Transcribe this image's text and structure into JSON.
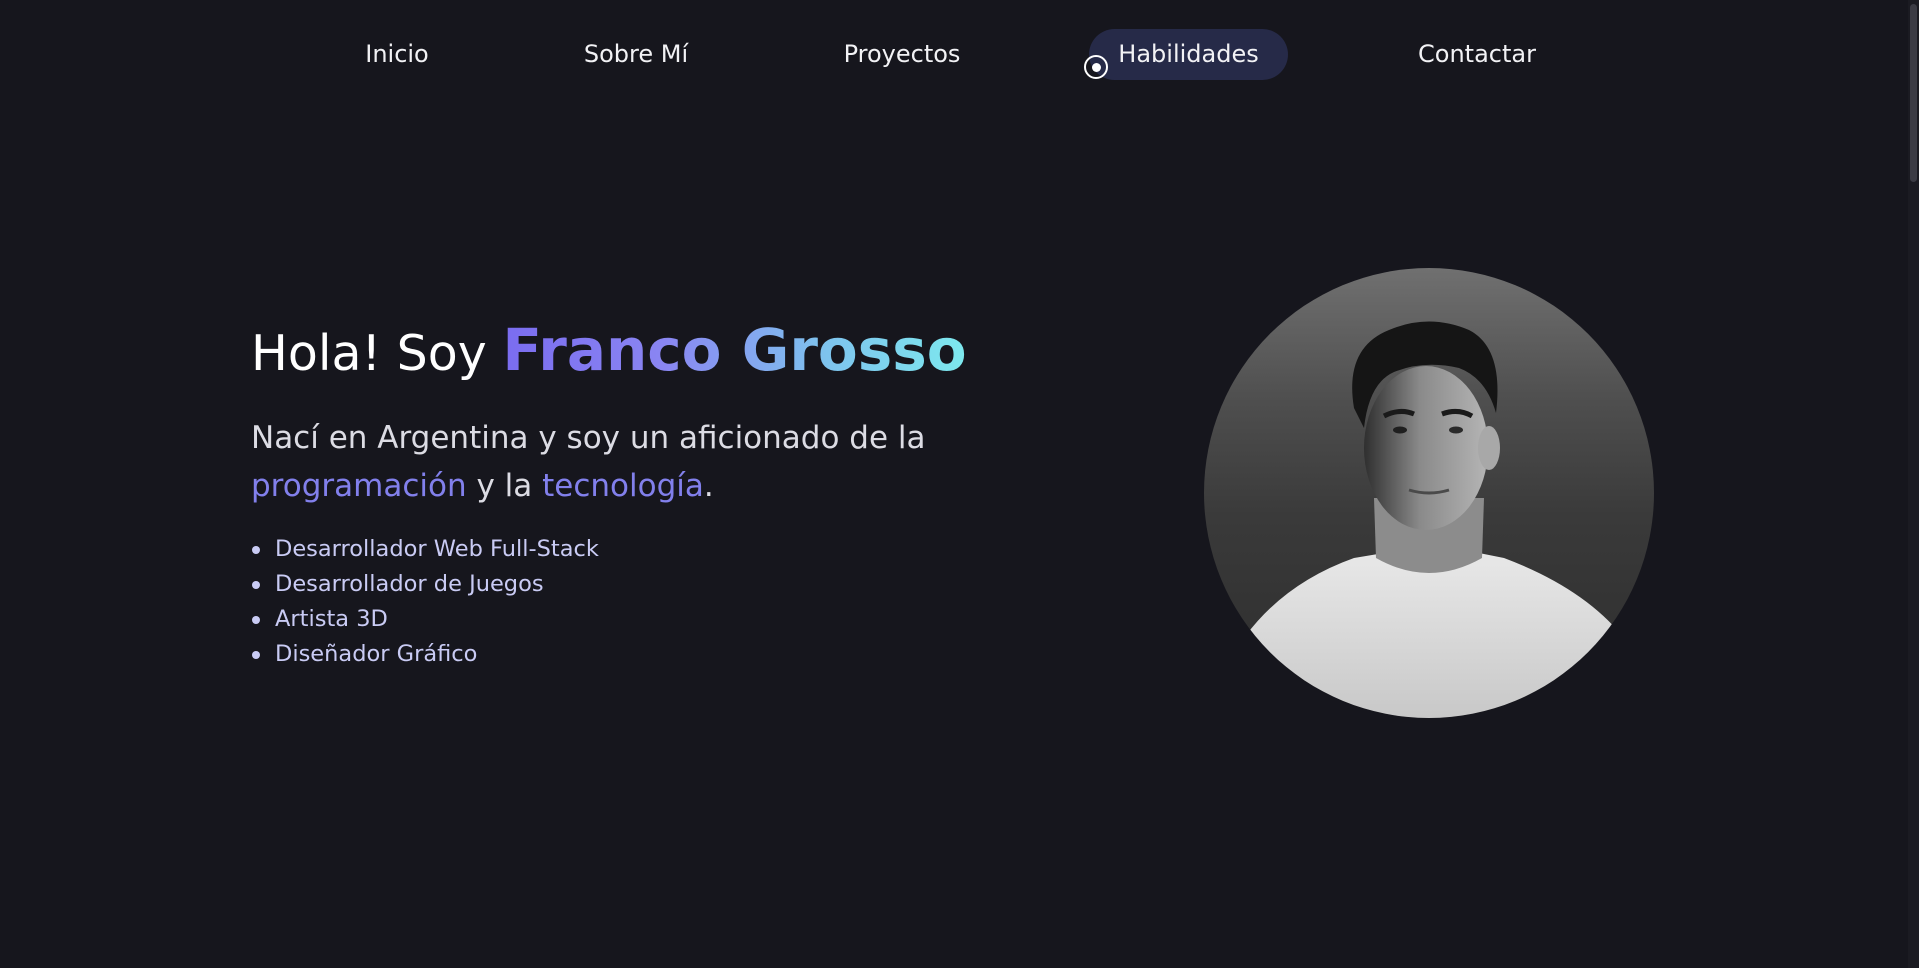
{
  "nav": {
    "items": [
      {
        "label": "Inicio"
      },
      {
        "label": "Sobre Mí"
      },
      {
        "label": "Proyectos"
      },
      {
        "label": "Habilidades",
        "active": true
      },
      {
        "label": "Contactar"
      }
    ]
  },
  "hero": {
    "greeting_prefix": "Hola! Soy",
    "name": "Franco Grosso",
    "intro_part1": "Nací en Argentina y soy un aficionado de la",
    "intro_accent1": "programación",
    "intro_part2": "y la",
    "intro_accent2": "tecnología",
    "intro_end": ".",
    "roles": [
      "Desarrollador Web Full-Stack",
      "Desarrollador de Juegos",
      "Artista 3D",
      "Diseñador Gráfico"
    ]
  },
  "avatar": {
    "icon": "profile-photo-icon"
  },
  "colors": {
    "background": "#16161d",
    "nav_active_bg": "#262a48",
    "accent": "#8280ec",
    "name_gradient_start": "#7a6cf0",
    "name_gradient_end": "#7de9ee",
    "role_text": "#c9cbf4"
  }
}
